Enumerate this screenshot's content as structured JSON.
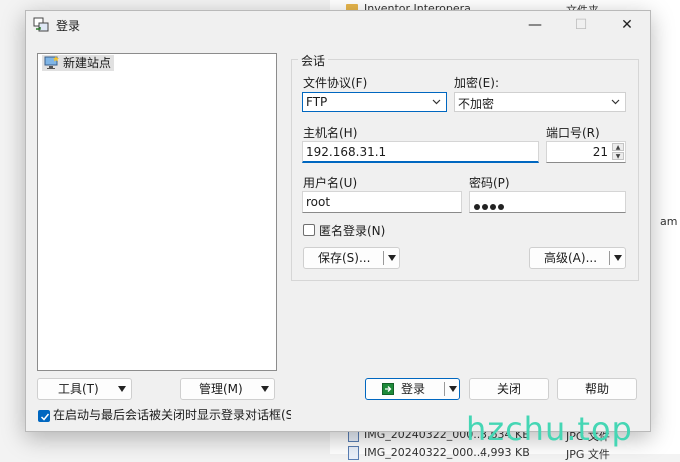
{
  "background": {
    "folder_label": "Inventor Interopera",
    "type_folder": "文件夹",
    "suffix_text": "am",
    "files": [
      {
        "name": "IMG_20240322_000...",
        "size": "3,634 KB",
        "type": "JPG 文件"
      },
      {
        "name": "IMG_20240322_000...",
        "size": "4,993 KB",
        "type": "JPG 文件"
      }
    ]
  },
  "dialog": {
    "title": "登录",
    "window_controls": {
      "minimize": "—",
      "maximize": "☐",
      "close": "✕"
    },
    "site_tree": {
      "items": [
        "新建站点"
      ]
    },
    "session": {
      "group_title": "会话",
      "protocol_label": "文件协议(F)",
      "protocol_value": "FTP",
      "encryption_label": "加密(E):",
      "encryption_value": "不加密",
      "host_label": "主机名(H)",
      "host_value": "192.168.31.1",
      "port_label": "端口号(R)",
      "port_value": "21",
      "user_label": "用户名(U)",
      "user_value": "root",
      "password_label": "密码(P)",
      "password_dots": 4,
      "anonymous_label": "匿名登录(N)",
      "anonymous_checked": false,
      "save_button": "保存(S)...",
      "advanced_button": "高级(A)..."
    },
    "buttons": {
      "tools": "工具(T)",
      "manage": "管理(M)",
      "login": "登录",
      "close": "关闭",
      "help": "帮助"
    },
    "startup_checkbox": {
      "label": "在启动与最后会话被关闭时显示登录对话框(S",
      "checked": true
    }
  },
  "watermark": "hzchu.top",
  "colors": {
    "accent": "#0067c0",
    "watermark": "#45d6b4"
  }
}
